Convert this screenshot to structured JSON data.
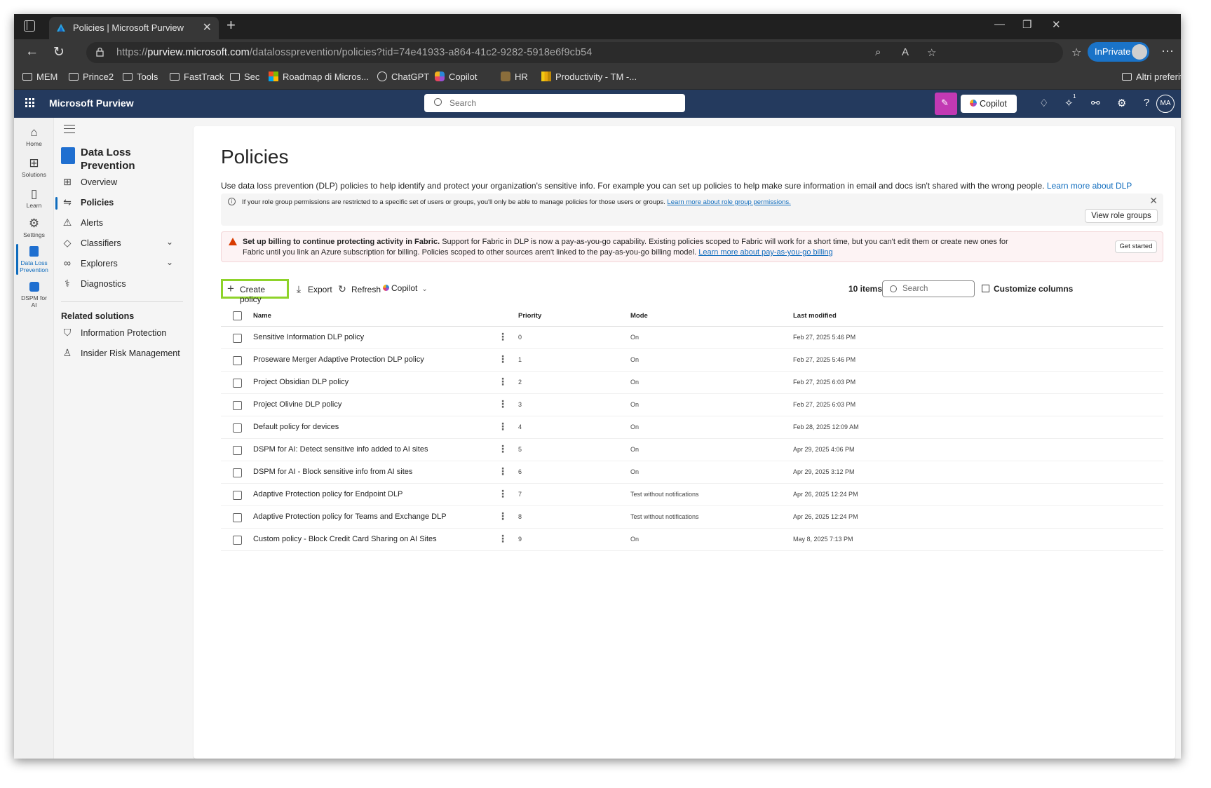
{
  "browser": {
    "tab_title": "Policies | Microsoft Purview",
    "url_prefix": "https://",
    "url_domain": "purview.microsoft.com",
    "url_path": "/datalossprevention/policies?tid=74e41933-a864-41c2-9282-5918e6f9cb54",
    "inprivate_label": "InPrivate",
    "bookmarks": [
      "MEM",
      "Prince2",
      "Tools",
      "FastTrack",
      "Sec",
      "Roadmap di Micros...",
      "ChatGPT",
      "Copilot",
      "HR",
      "Productivity - TM -..."
    ],
    "other_favorites": "Altri preferiti"
  },
  "header": {
    "app_title": "Microsoft Purview",
    "search_placeholder": "Search",
    "copilot_label": "Copilot",
    "avatar_initials": "MA",
    "notification_count": "1"
  },
  "rail": {
    "items": [
      {
        "label": "Home",
        "icon": "home-icon"
      },
      {
        "label": "Solutions",
        "icon": "solutions-icon"
      },
      {
        "label": "Learn",
        "icon": "book-icon"
      },
      {
        "label": "Settings",
        "icon": "gear-icon"
      },
      {
        "label": "Data Loss Prevention",
        "icon": "dlp-icon"
      },
      {
        "label": "DSPM for AI",
        "icon": "dspm-icon"
      }
    ]
  },
  "nav": {
    "solution_title": "Data Loss Prevention",
    "items": [
      {
        "label": "Overview"
      },
      {
        "label": "Policies"
      },
      {
        "label": "Alerts"
      },
      {
        "label": "Classifiers"
      },
      {
        "label": "Explorers"
      },
      {
        "label": "Diagnostics"
      }
    ],
    "related_heading": "Related solutions",
    "related": [
      {
        "label": "Information Protection"
      },
      {
        "label": "Insider Risk Management"
      }
    ]
  },
  "main": {
    "title": "Policies",
    "description": "Use data loss prevention (DLP) policies to help identify and protect your organization's sensitive info. For example you can set up policies to help make sure information in email and docs isn't shared with the wrong people.",
    "description_link": "Learn more about DLP",
    "info_text": "If your role group permissions are restricted to a specific set of users or groups, you'll only be able to manage policies for those users or groups.",
    "info_link": "Learn more about role group permissions.",
    "view_role_groups": "View role groups",
    "warning_bold": "Set up billing to continue protecting activity in Fabric.",
    "warning_text": "Support for Fabric in DLP is now a pay-as-you-go capability. Existing policies scoped to Fabric will work for a short time, but you can't edit them or create new ones for Fabric until you link an Azure subscription for billing. Policies scoped to other sources aren't linked to the pay-as-you-go billing model.",
    "warning_link": "Learn more about pay-as-you-go billing",
    "get_started": "Get started"
  },
  "toolbar": {
    "create_policy": "Create policy",
    "export": "Export",
    "refresh": "Refresh",
    "copilot": "Copilot",
    "items_count": "10 items",
    "search_placeholder": "Search",
    "customize_columns": "Customize columns"
  },
  "table": {
    "columns": {
      "name": "Name",
      "priority": "Priority",
      "mode": "Mode",
      "last_modified": "Last modified"
    },
    "rows": [
      {
        "name": "Sensitive Information DLP policy",
        "priority": "0",
        "mode": "On",
        "modified": "Feb 27, 2025 5:46 PM"
      },
      {
        "name": "Proseware Merger Adaptive Protection DLP policy",
        "priority": "1",
        "mode": "On",
        "modified": "Feb 27, 2025 5:46 PM"
      },
      {
        "name": "Project Obsidian DLP policy",
        "priority": "2",
        "mode": "On",
        "modified": "Feb 27, 2025 6:03 PM"
      },
      {
        "name": "Project Olivine DLP policy",
        "priority": "3",
        "mode": "On",
        "modified": "Feb 27, 2025 6:03 PM"
      },
      {
        "name": "Default policy for devices",
        "priority": "4",
        "mode": "On",
        "modified": "Feb 28, 2025 12:09 AM"
      },
      {
        "name": "DSPM for AI: Detect sensitive info added to AI sites",
        "priority": "5",
        "mode": "On",
        "modified": "Apr 29, 2025 4:06 PM"
      },
      {
        "name": "DSPM for AI - Block sensitive info from AI sites",
        "priority": "6",
        "mode": "On",
        "modified": "Apr 29, 2025 3:12 PM"
      },
      {
        "name": "Adaptive Protection policy for Endpoint DLP",
        "priority": "7",
        "mode": "Test without notifications",
        "modified": "Apr 26, 2025 12:24 PM"
      },
      {
        "name": "Adaptive Protection policy for Teams and Exchange DLP",
        "priority": "8",
        "mode": "Test without notifications",
        "modified": "Apr 26, 2025 12:24 PM"
      },
      {
        "name": "Custom policy - Block Credit Card Sharing on AI Sites",
        "priority": "9",
        "mode": "On",
        "modified": "May 8, 2025 7:13 PM"
      }
    ]
  },
  "colors": {
    "header_bg": "#243a5e",
    "accent": "#0f6cbd",
    "highlight": "#8ed32a",
    "warning": "#d83b01",
    "copilot_pink": "#c239b3"
  }
}
